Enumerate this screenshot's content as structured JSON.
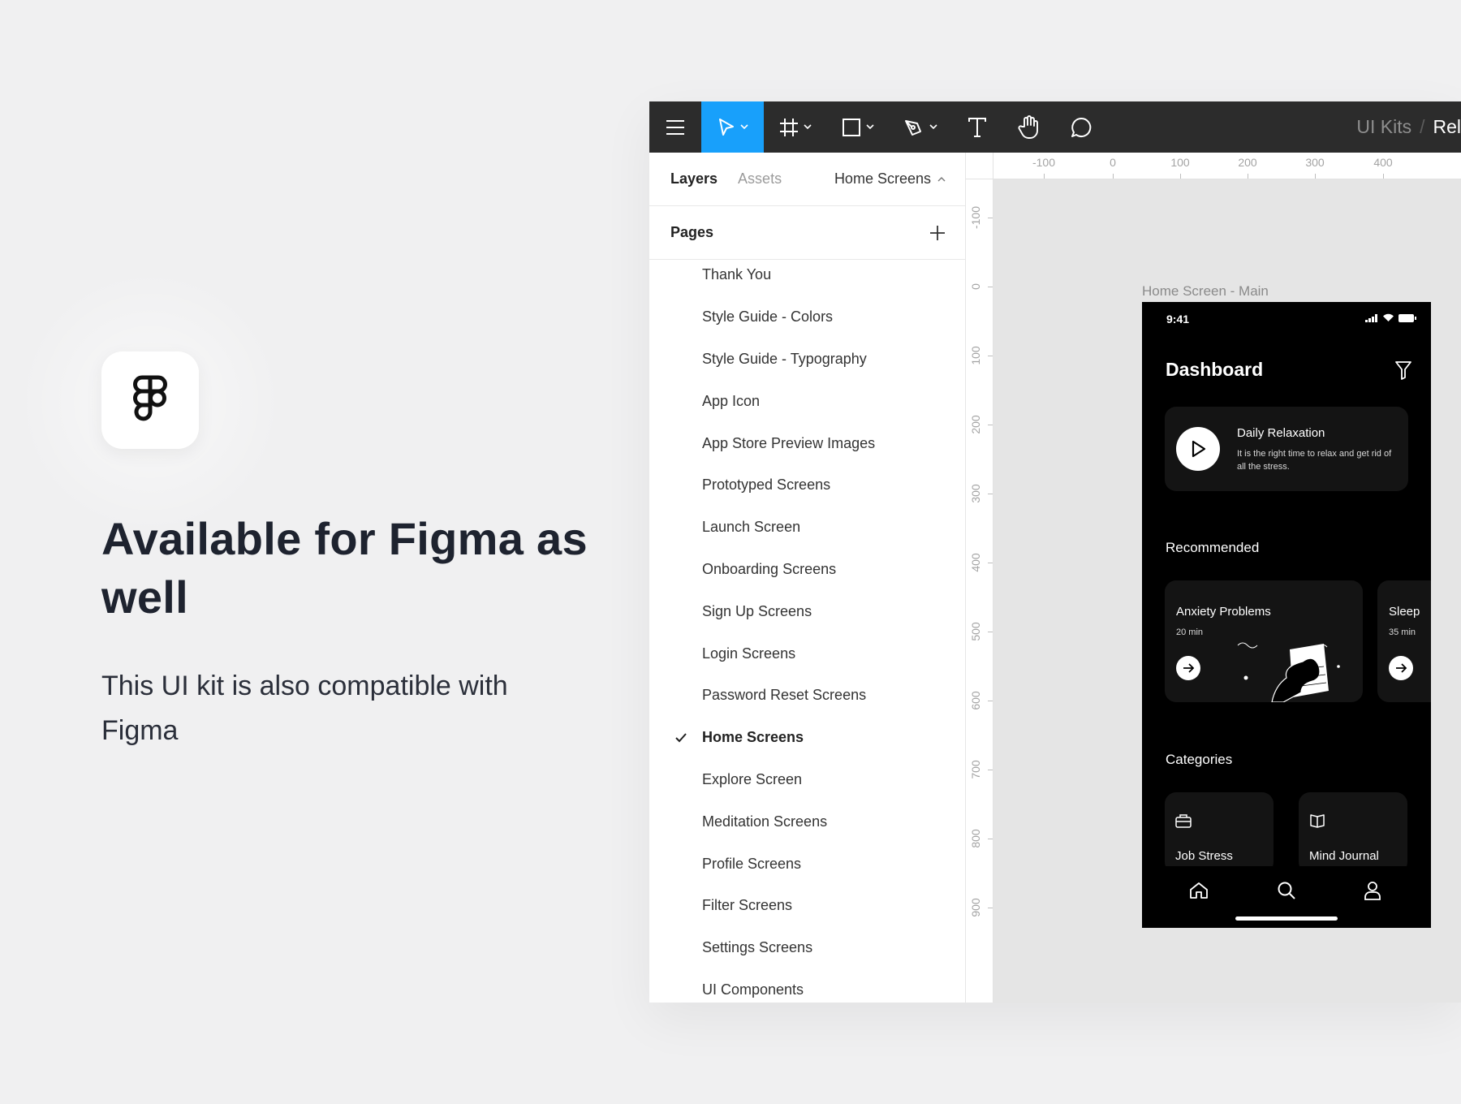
{
  "promo": {
    "logo_icon": "figma-logo-icon",
    "headline": "Available for Figma as well",
    "subline": "This UI kit is also compatible with Figma"
  },
  "toolbar": {
    "tools": [
      "menu-icon",
      "move-tool-icon",
      "frame-tool-icon",
      "shape-tool-icon",
      "pen-tool-icon",
      "text-tool-icon",
      "hand-tool-icon",
      "comment-tool-icon"
    ],
    "active_tool": "move-tool-icon",
    "accent": "#18a0fb",
    "breadcrumb_parent": "UI Kits",
    "breadcrumb_separator": "/",
    "breadcrumb_current": "Rel"
  },
  "panel": {
    "tab_layers": "Layers",
    "tab_assets": "Assets",
    "current_page": "Home Screens",
    "pages_title": "Pages",
    "pages": [
      "Thank You",
      "Style Guide - Colors",
      "Style Guide - Typography",
      "App Icon",
      "App Store Preview Images",
      "Prototyped Screens",
      "Launch Screen",
      "Onboarding Screens",
      "Sign Up Screens",
      "Login Screens",
      "Password Reset Screens",
      "Home Screens",
      "Explore Screen",
      "Meditation Screens",
      "Profile Screens",
      "Filter Screens",
      "Settings Screens",
      "UI Components"
    ],
    "active_index": 11
  },
  "rulers": {
    "top": [
      "-100",
      "0",
      "100",
      "200",
      "300",
      "400"
    ],
    "left": [
      "-100",
      "0",
      "100",
      "200",
      "300",
      "400",
      "500",
      "600",
      "700",
      "800",
      "900"
    ]
  },
  "frame": {
    "label": "Home Screen - Main",
    "time": "9:41",
    "title": "Dashboard",
    "relax_title": "Daily Relaxation",
    "relax_desc": "It is the right time to relax and get rid of all the stress.",
    "recommended": "Recommended",
    "rec_cards": [
      {
        "title": "Anxiety Problems",
        "sub": "20 min"
      },
      {
        "title": "Sleep",
        "sub": "35 min"
      }
    ],
    "categories": "Categories",
    "cat_cards": [
      {
        "label": "Job Stress",
        "icon": "briefcase-icon"
      },
      {
        "label": "Mind Journal",
        "icon": "book-icon"
      }
    ]
  }
}
